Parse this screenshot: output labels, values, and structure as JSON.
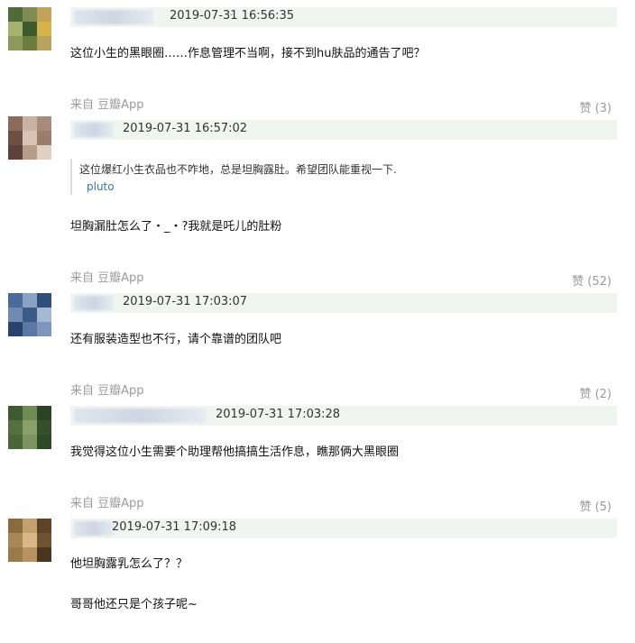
{
  "comments": [
    {
      "source": "",
      "likes": "",
      "time": "2019-07-31 16:56:35",
      "quote": null,
      "text": [
        "这位小生的黑眼圈……作息管理不当啊，接不到hu肤品的通告了吧？"
      ],
      "avatar_colors": [
        "#4f6b3a",
        "#7f8c55",
        "#c4a25a",
        "#a5b36e",
        "#3d5a2c",
        "#d6b24a",
        "#8c9a5b",
        "#6a7d3f",
        "#b8a35e"
      ]
    },
    {
      "source": "来自 豆瓣App",
      "likes": "赞 (3)",
      "time": "2019-07-31 16:57:02",
      "quote": {
        "text": "这位爆红小生衣品也不咋地，总是坦胸露肚。希望团队能重视一下.",
        "author": "pluto"
      },
      "text": [
        "坦胸漏肚怎么了・_・?我就是吒儿的肚粉"
      ],
      "avatar_colors": [
        "#8a6b5c",
        "#c9b2a3",
        "#a88b7a",
        "#6e4f43",
        "#d8c3b4",
        "#9b7d6e",
        "#5c4238",
        "#b79c8c",
        "#e0d0c3"
      ]
    },
    {
      "source": "来自 豆瓣App",
      "likes": "赞 (52)",
      "time": "2019-07-31 17:03:07",
      "quote": null,
      "text": [
        "还有服装造型也不行，请个靠谱的团队吧"
      ],
      "avatar_colors": [
        "#4b6a9a",
        "#8aa3c4",
        "#2f4e7a",
        "#6f8bb3",
        "#3c5a88",
        "#a6b9d3",
        "#27426b",
        "#5a78a6",
        "#7e96bd"
      ]
    },
    {
      "source": "来自 豆瓣App",
      "likes": "赞 (2)",
      "time": "2019-07-31 17:03:28",
      "quote": null,
      "text": [
        "我觉得这位小生需要个助理帮他搞搞生活作息，瞧那俩大黑眼圈"
      ],
      "avatar_colors": [
        "#3f5a33",
        "#6f8a52",
        "#2c4324",
        "#557040",
        "#8aa06a",
        "#364e2b",
        "#4a6638",
        "#7a955f",
        "#2f4a28"
      ]
    },
    {
      "source": "来自 豆瓣App",
      "likes": "赞 (5)",
      "time": "2019-07-31 17:09:18",
      "quote": null,
      "text": [
        "他坦胸露乳怎么了？？",
        "哥哥他还只是个孩子呢~"
      ],
      "avatar_colors": [
        "#8c6a3f",
        "#c2a070",
        "#5d4426",
        "#a88655",
        "#d7b886",
        "#6f5432",
        "#9b7a49",
        "#b8935f",
        "#4a361e"
      ]
    }
  ]
}
